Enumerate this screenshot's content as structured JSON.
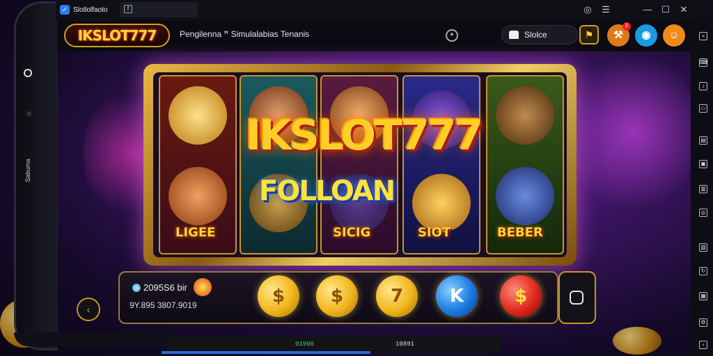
{
  "titlebar": {
    "app_tab_label": "Slotlolfaoto",
    "tab2_icon": "f",
    "window_controls": [
      "record-icon",
      "menu-icon",
      "minimize-icon",
      "maximize-icon",
      "close-icon"
    ]
  },
  "header": {
    "logo_text": "IKSLOT777",
    "title": "Pengilenna ꟸ Simulalabias Tenanis",
    "search_label": "Slolce",
    "notification_count": "2"
  },
  "phone": {
    "side_label": "Sabuma"
  },
  "board": {
    "big_logo": "IKSLOT777",
    "feature_text": "FOLLOAN",
    "reel_labels": [
      "LIGEE",
      "SICIG",
      "SIOT",
      "BEBER"
    ]
  },
  "controls": {
    "balance_line1": "2095S6 bir",
    "balance_line2": "9Y.895 3807.9019",
    "coins": [
      {
        "label": "$",
        "color": "#f2b51c"
      },
      {
        "label": "$",
        "color": "#f2b51c"
      },
      {
        "label": "7",
        "color": "#f2b51c"
      },
      {
        "label": "K",
        "color": "#1a7ae0"
      },
      {
        "label": "$",
        "color": "#e0281c"
      }
    ]
  },
  "statusbar": {
    "green_text": "01906",
    "white_text": "10891"
  },
  "colors": {
    "accent_gold": "#d8a022",
    "background_purple": "#3a1460"
  }
}
